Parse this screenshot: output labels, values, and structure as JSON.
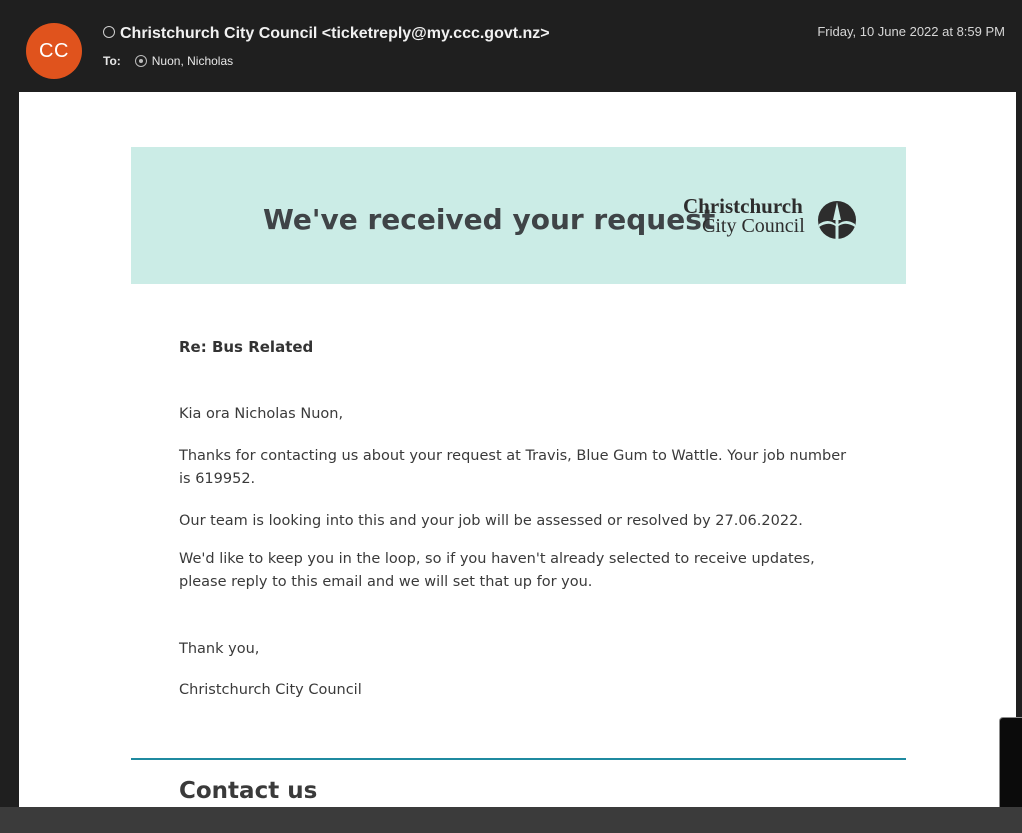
{
  "header": {
    "avatar_initials": "CC",
    "sender": "Christchurch City Council <ticketreply@my.ccc.govt.nz>",
    "to_label": "To:",
    "recipient": "Nuon, Nicholas",
    "date": "Friday, 10 June 2022 at 8:59 PM",
    "avatar_color": "#e0531d"
  },
  "email": {
    "banner": {
      "title": "We've received your request",
      "logo_line1": "Christchurch",
      "logo_line2": "City Council",
      "background": "#cbece6"
    },
    "subject": "Re: Bus Related",
    "greeting": "Kia ora Nicholas Nuon,",
    "para1": "Thanks for contacting us about your request at Travis, Blue Gum to Wattle. Your job number is 619952.",
    "para2": "Our team is looking into this and your job will be assessed or resolved by 27.06.2022.",
    "para3": "We'd like to keep you in the loop, so if you haven't already selected to receive updates, please reply to this email and we will set that up for you.",
    "thanks": "Thank you,",
    "signature": "Christchurch City Council",
    "contact_heading": "Contact us",
    "divider_color": "#1f8aa0"
  }
}
